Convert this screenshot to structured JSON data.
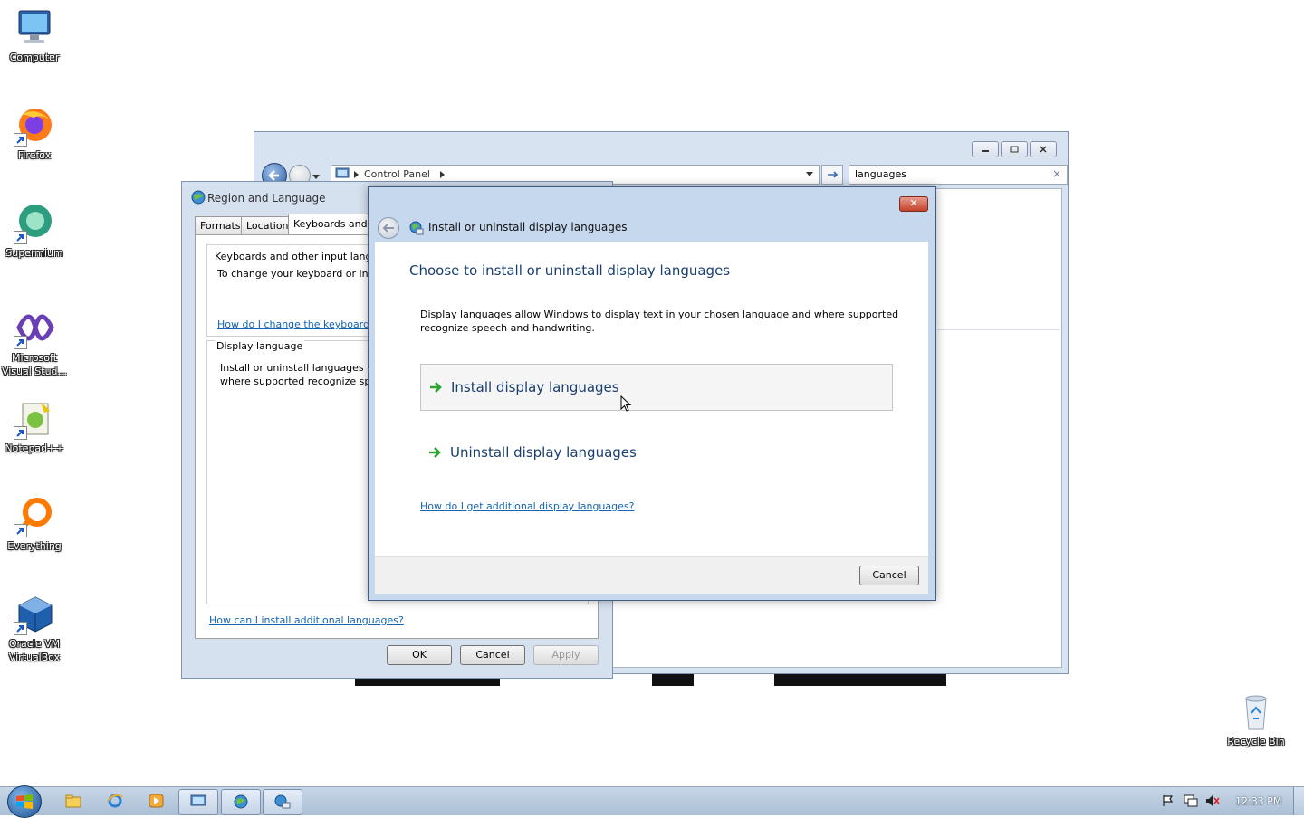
{
  "desktop": {
    "icons": [
      {
        "label": "Computer",
        "icon": "computer-icon"
      },
      {
        "label": "Firefox",
        "icon": "firefox-icon"
      },
      {
        "label": "Supermium",
        "icon": "supermium-icon"
      },
      {
        "label": "Microsoft Visual Stud...",
        "icon": "visual-studio-icon"
      },
      {
        "label": "Notepad++",
        "icon": "notepadpp-icon"
      },
      {
        "label": "Everything",
        "icon": "everything-icon"
      },
      {
        "label": "Oracle VM VirtualBox",
        "icon": "virtualbox-icon"
      },
      {
        "label": "Recycle Bin",
        "icon": "recycle-bin-icon"
      }
    ]
  },
  "control_panel": {
    "breadcrumb": "Control Panel",
    "search_value": "languages",
    "clear_glyph": "×"
  },
  "region_language": {
    "title": "Region and Language",
    "tabs": [
      "Formats",
      "Location",
      "Keyboards and La"
    ],
    "keyboards_heading": "Keyboards and other input langu",
    "keyboards_text": "To change your keyboard or inp",
    "keyboards_link": "How do I change the keyboard l",
    "display_heading": "Display language",
    "display_text_1": "Install or uninstall languages th",
    "display_text_2": "where supported recognize spe",
    "install_link": "How can I install additional languages?",
    "buttons": {
      "ok": "OK",
      "cancel": "Cancel",
      "apply": "Apply"
    }
  },
  "install_dialog": {
    "title": "Install or uninstall display languages",
    "close_glyph": "✕",
    "heading": "Choose to install or uninstall display languages",
    "description_1": "Display languages allow Windows to display text in your chosen language and where supported",
    "description_2": "recognize speech and handwriting.",
    "options": [
      "Install display languages",
      "Uninstall display languages"
    ],
    "help_link": "How do I get additional display languages?",
    "cancel": "Cancel"
  },
  "taskbar": {
    "clock": "12:33 PM",
    "pinned": [
      "explorer-icon",
      "internet-explorer-icon",
      "media-player-icon"
    ],
    "open": [
      "control-panel-icon",
      "region-language-icon",
      "install-languages-icon"
    ]
  },
  "colors": {
    "accent_link": "#1464b4",
    "heading_blue": "#1a3e6e",
    "task_arrow_green": "#2fa32f",
    "window_frame": "#c6d8ee"
  }
}
